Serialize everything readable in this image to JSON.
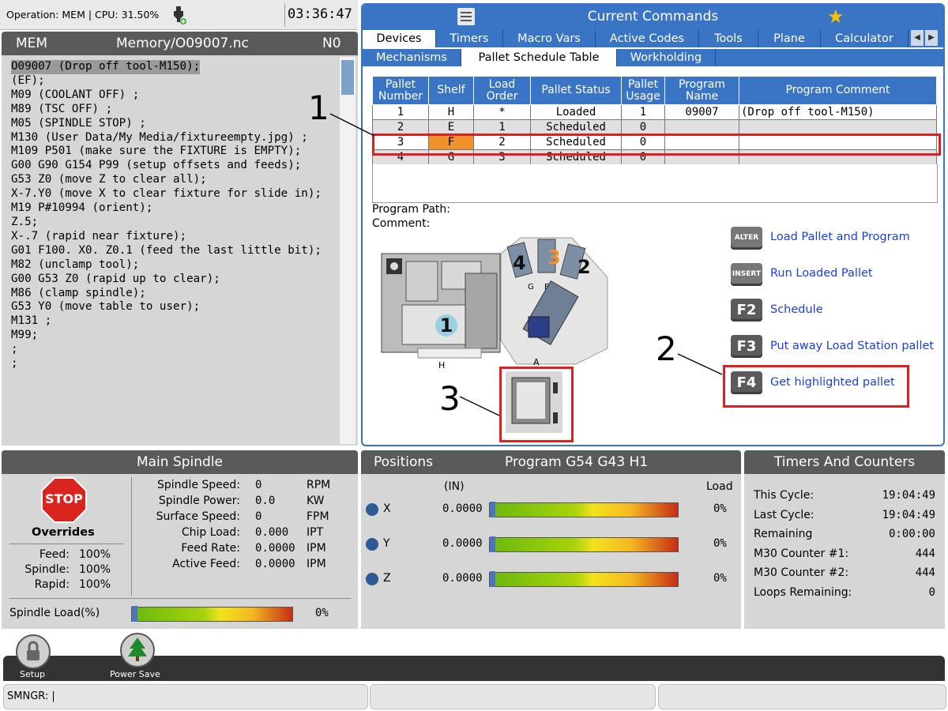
{
  "topbar": {
    "operation": "Operation: MEM | CPU: 31.50%",
    "clock": "03:36:47"
  },
  "left": {
    "mode": "MEM",
    "file": "Memory/O09007.nc",
    "n": "N0",
    "lines": [
      "O09007 (Drop off tool-M150);",
      "(EF);",
      "M09 (COOLANT OFF) ;",
      "M89 (TSC OFF) ;",
      "M05 (SPINDLE STOP) ;",
      "M130 (User Data/My Media/fixtureempty.jpg) ;",
      "M109 P501 (make sure the FIXTURE is EMPTY);",
      "G00 G90 G154 P99 (setup offsets and feeds);",
      "G53 Z0 (move Z to clear all);",
      "X-7.Y0 (move X to clear fixture for slide in);",
      "M19 P#10994 (orient);",
      "Z.5;",
      "X-.7 (rapid near fixture);",
      "G01 F100. X0. Z0.1 (feed the last little bit);",
      "M82 (unclamp tool);",
      "G00 G53 Z0 (rapid up to clear);",
      "M86 (clamp spindle);",
      "G53 Y0 (move table to user);",
      "M131 ;",
      "M99;",
      ";",
      ";"
    ]
  },
  "right": {
    "title": "Current Commands",
    "tabs": [
      "Devices",
      "Timers",
      "Macro Vars",
      "Active Codes",
      "Tools",
      "Plane",
      "Calculator"
    ],
    "subtabs": [
      "Mechanisms",
      "Pallet Schedule Table",
      "Workholding"
    ],
    "columns": [
      "Pallet Number",
      "Shelf",
      "Load Order",
      "Pallet Status",
      "Pallet Usage",
      "Program Name",
      "Program Comment"
    ],
    "rows": [
      [
        "1",
        "H",
        "*",
        "Loaded",
        "1",
        "09007",
        "(Drop off tool-M150)"
      ],
      [
        "2",
        "E",
        "1",
        "Scheduled",
        "0",
        "",
        ""
      ],
      [
        "3",
        "F",
        "2",
        "Scheduled",
        "0",
        "",
        ""
      ],
      [
        "4",
        "G",
        "3",
        "Scheduled",
        "0",
        "",
        ""
      ]
    ],
    "program_path_label": "Program Path:",
    "comment_label": "Comment:",
    "actions": [
      {
        "key": "ALTER",
        "label": "Load Pallet and Program"
      },
      {
        "key": "INSERT",
        "label": "Run Loaded Pallet"
      },
      {
        "key": "F2",
        "label": "Schedule"
      },
      {
        "key": "F3",
        "label": "Put away Load Station pallet"
      },
      {
        "key": "F4",
        "label": "Get highlighted pallet"
      }
    ],
    "diagram": {
      "p1": "1",
      "p2": "2",
      "p3": "3",
      "p4": "4",
      "shelf_h": "H",
      "shelf_g": "G",
      "shelf_f": "F",
      "shelf_a": "A"
    },
    "callouts": [
      "1",
      "2",
      "3"
    ]
  },
  "spindle": {
    "title": "Main Spindle",
    "stop": "STOP",
    "overrides_label": "Overrides",
    "overrides": [
      [
        "Feed:",
        "100%"
      ],
      [
        "Spindle:",
        "100%"
      ],
      [
        "Rapid:",
        "100%"
      ]
    ],
    "stats": [
      [
        "Spindle Speed:",
        "0",
        "RPM"
      ],
      [
        "Spindle Power:",
        "0.0",
        "KW"
      ],
      [
        "Surface Speed:",
        "0",
        "FPM"
      ],
      [
        "Chip Load:",
        "0.000",
        "IPT"
      ],
      [
        "Feed Rate:",
        "0.0000",
        "IPM"
      ],
      [
        "Active Feed:",
        "0.0000",
        "IPM"
      ]
    ],
    "load_label": "Spindle Load(%)",
    "load_value": "0%"
  },
  "positions": {
    "title": "Positions",
    "program": "Program G54 G43 H1",
    "unit": "(IN)",
    "load": "Load",
    "axes": [
      {
        "axis": "X",
        "value": "0.0000",
        "load": "0%"
      },
      {
        "axis": "Y",
        "value": "0.0000",
        "load": "0%"
      },
      {
        "axis": "Z",
        "value": "0.0000",
        "load": "0%"
      }
    ]
  },
  "timers": {
    "title": "Timers And Counters",
    "items": [
      [
        "This Cycle:",
        "19:04:49"
      ],
      [
        "Last Cycle:",
        "19:04:49"
      ],
      [
        "Remaining",
        "0:00:00"
      ],
      [
        "M30 Counter #1:",
        "444"
      ],
      [
        "M30 Counter #2:",
        "444"
      ],
      [
        "Loops Remaining:",
        "0"
      ]
    ]
  },
  "taskbar": {
    "setup": "Setup",
    "power": "Power Save"
  },
  "status": {
    "cmd": "SMNGR: |"
  }
}
